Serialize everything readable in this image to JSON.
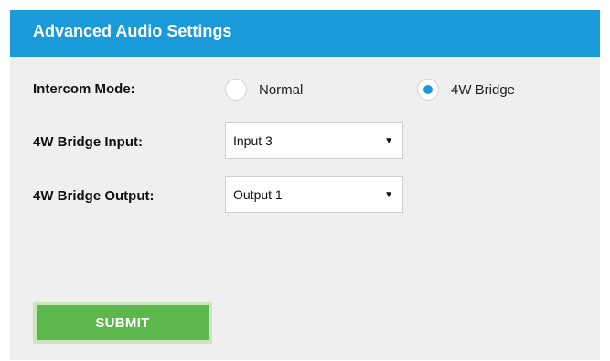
{
  "panel": {
    "title": "Advanced Audio Settings"
  },
  "intercom_mode": {
    "label": "Intercom Mode:",
    "options": [
      {
        "label": "Normal",
        "selected": false
      },
      {
        "label": "4W Bridge",
        "selected": true
      }
    ]
  },
  "bridge_input": {
    "label": "4W Bridge Input:",
    "value": "Input 3"
  },
  "bridge_output": {
    "label": "4W Bridge Output:",
    "value": "Output 1"
  },
  "submit": {
    "label": "SUBMIT"
  },
  "colors": {
    "header": "#1a9ad8",
    "panel_bg": "#efefef",
    "radio_selected": "#1a9ad8",
    "submit_bg": "#5cb84d",
    "submit_border": "#c9e7bb"
  },
  "icons": {
    "dropdown_caret": "triangle-down-icon"
  }
}
